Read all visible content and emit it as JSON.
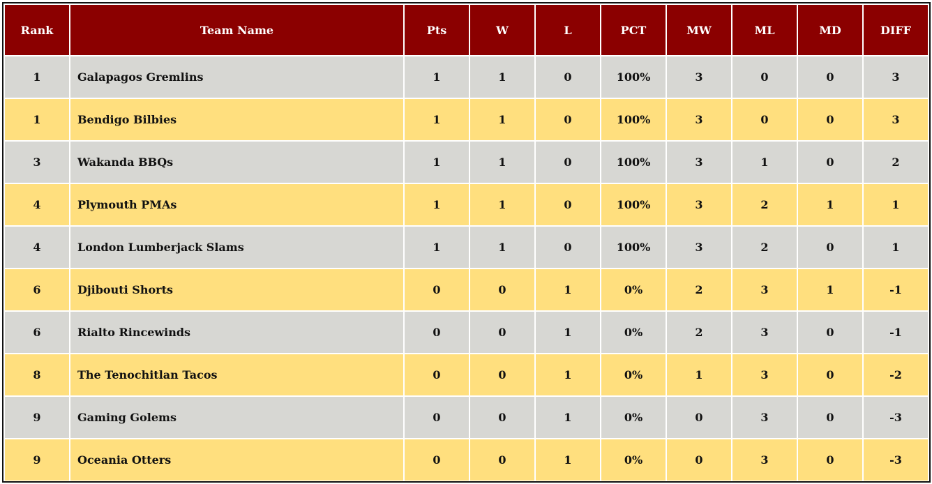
{
  "colors": {
    "header_bg": "#8b0000",
    "row_odd": "#d7d7d3",
    "row_even": "#ffdf7e"
  },
  "columns": [
    "Rank",
    "Team Name",
    "Pts",
    "W",
    "L",
    "PCT",
    "MW",
    "ML",
    "MD",
    "DIFF"
  ],
  "rows": [
    [
      "1",
      "Galapagos Gremlins",
      "1",
      "1",
      "0",
      "100%",
      "3",
      "0",
      "0",
      "3"
    ],
    [
      "1",
      "Bendigo Bilbies",
      "1",
      "1",
      "0",
      "100%",
      "3",
      "0",
      "0",
      "3"
    ],
    [
      "3",
      "Wakanda BBQs",
      "1",
      "1",
      "0",
      "100%",
      "3",
      "1",
      "0",
      "2"
    ],
    [
      "4",
      "Plymouth PMAs",
      "1",
      "1",
      "0",
      "100%",
      "3",
      "2",
      "1",
      "1"
    ],
    [
      "4",
      "London Lumberjack Slams",
      "1",
      "1",
      "0",
      "100%",
      "3",
      "2",
      "0",
      "1"
    ],
    [
      "6",
      "Djibouti Shorts",
      "0",
      "0",
      "1",
      "0%",
      "2",
      "3",
      "1",
      "-1"
    ],
    [
      "6",
      "Rialto Rincewinds",
      "0",
      "0",
      "1",
      "0%",
      "2",
      "3",
      "0",
      "-1"
    ],
    [
      "8",
      "The Tenochitlan Tacos",
      "0",
      "0",
      "1",
      "0%",
      "1",
      "3",
      "0",
      "-2"
    ],
    [
      "9",
      "Gaming Golems",
      "0",
      "0",
      "1",
      "0%",
      "0",
      "3",
      "0",
      "-3"
    ],
    [
      "9",
      "Oceania Otters",
      "0",
      "0",
      "1",
      "0%",
      "0",
      "3",
      "0",
      "-3"
    ]
  ]
}
